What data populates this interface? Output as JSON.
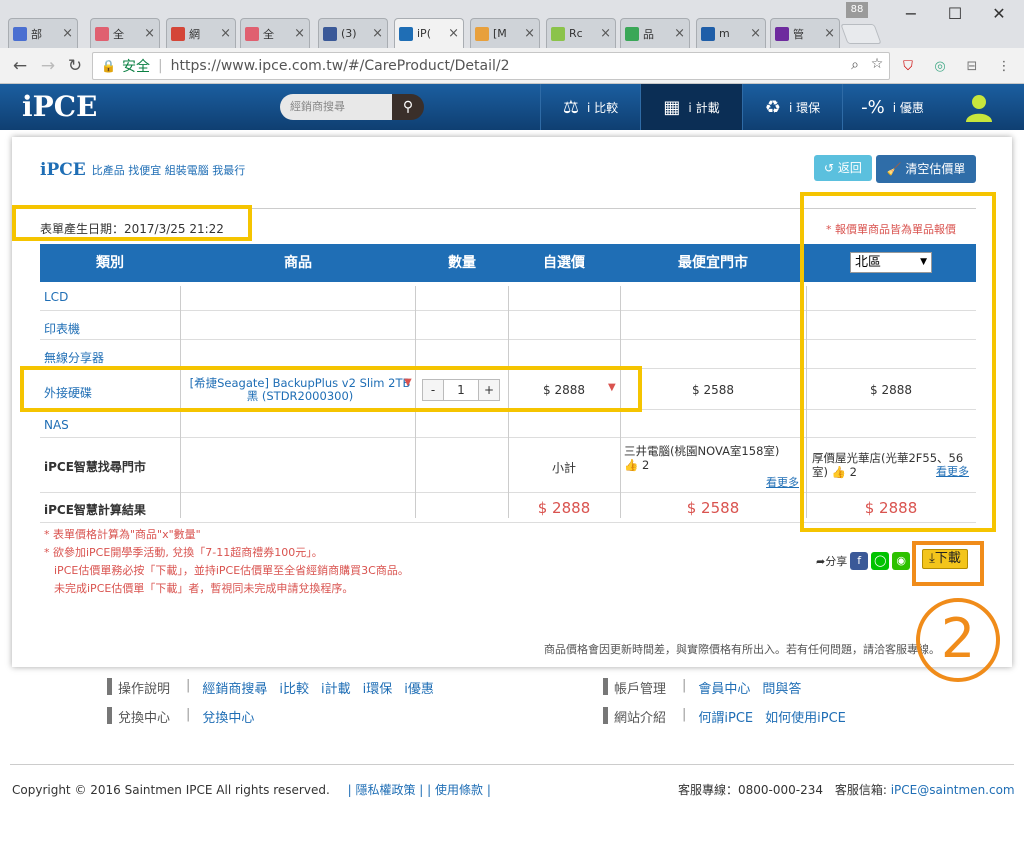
{
  "browser": {
    "profile_count": "88",
    "tabs": [
      {
        "label": "部",
        "color": "#4a6fd1"
      },
      {
        "label": "全",
        "color": "#e06070"
      },
      {
        "label": "網",
        "color": "#d44638"
      },
      {
        "label": "全",
        "color": "#e06070"
      },
      {
        "label": "(3)",
        "color": "#3b5998"
      },
      {
        "label": "iP(",
        "color": "#1f6eb5"
      },
      {
        "label": "[M",
        "color": "#e8a03c"
      },
      {
        "label": "Rc",
        "color": "#8bc34a"
      },
      {
        "label": "品",
        "color": "#3aa757"
      },
      {
        "label": "m",
        "color": "#1f5ea8"
      },
      {
        "label": "管",
        "color": "#6e2b9e"
      }
    ],
    "secure_label": "安全",
    "url": "https://www.ipce.com.tw/#/CareProduct/Detail/2"
  },
  "site": {
    "logo": "iPCE",
    "search_placeholder": "經銷商搜尋",
    "nav": [
      {
        "icon": "⚖",
        "label": "i 比較",
        "active": false
      },
      {
        "icon": "▦",
        "label": "i 計載",
        "active": true
      },
      {
        "icon": "♻",
        "label": "i 環保",
        "active": false
      },
      {
        "icon": "-%",
        "label": "i 優惠",
        "active": false
      }
    ]
  },
  "card": {
    "brand_logo": "iPCE",
    "tagline": "比產品 找便宜 組裝電腦 我最行",
    "back_label": "返回",
    "clear_label": "清空估價單",
    "generated": "表單產生日期：2017/3/25 21:22",
    "note": "* 報價單商品皆為單品報價",
    "region": "北區"
  },
  "table": {
    "headers": [
      "類別",
      "商品",
      "數量",
      "自選價",
      "最便宜門市"
    ],
    "rows": [
      {
        "category": "LCD"
      },
      {
        "category": "印表機"
      },
      {
        "category": "無線分享器"
      },
      {
        "category": "外接硬碟",
        "product": "[希捷Seagate] BackupPlus v2 Slim 2TB 黑 (STDR2000300)",
        "qty": "1",
        "minus": "-",
        "plus": "+",
        "own_price": "$ 2888",
        "cheapest": "$ 2588",
        "region_price": "$ 2888"
      },
      {
        "category": "NAS"
      }
    ],
    "store_row": {
      "label": "iPCE智慧找尋門市",
      "subtotal": "小計",
      "store1": "三井電腦(桃園NOVA室158室)",
      "store1_likes": "2",
      "store2": "厚價屋光華店(光華2F55、56室)",
      "store2_likes": "2",
      "more": "看更多"
    },
    "result_row": {
      "label": "iPCE智慧計算結果",
      "own_total": "$ 2888",
      "cheapest_total": "$ 2588",
      "region_total": "$ 2888"
    }
  },
  "footnotes": [
    "* 表單價格計算為\"商品\"x\"數量\"",
    "* 欲參加iPCE開學季活動, 兌換「7-11超商禮券100元」。",
    "iPCE估價單務必按「下載」，並持iPCE估價單至全省經銷商購買3C商品。",
    "未完成iPCE估價單「下載」者，暫視同未完成申請兌換程序。"
  ],
  "share_label": "分享",
  "download_label": "下載",
  "annotation_number": "2",
  "disclaimer": "商品價格會因更新時間差，與實際價格有所出入。若有任何問題，請洽客服專線。",
  "footer": {
    "col1": [
      {
        "head": "操作說明",
        "links": [
          "經銷商搜尋",
          "i比較",
          "i計載",
          "i環保",
          "i優惠"
        ]
      },
      {
        "head": "兌換中心",
        "links": [
          "兌換中心"
        ]
      }
    ],
    "col2": [
      {
        "head": "帳戶管理",
        "links": [
          "會員中心",
          "問與答"
        ]
      },
      {
        "head": "網站介紹",
        "links": [
          "何謂iPCE",
          "如何使用iPCE"
        ]
      }
    ],
    "copyright": "Copyright © 2016 Saintmen IPCE All rights reserved.",
    "privacy": "隱私權政策",
    "terms": "使用條款",
    "hotline": "客服專線：0800-000-234",
    "mail_label": "客服信箱:",
    "mail": "iPCE@saintmen.com"
  }
}
